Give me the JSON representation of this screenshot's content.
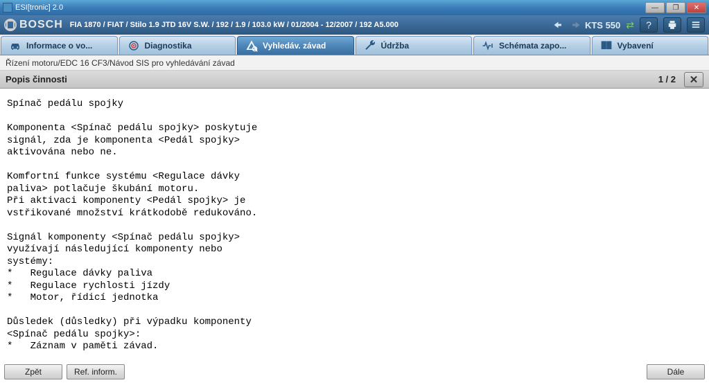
{
  "window": {
    "title": "ESI[tronic] 2.0"
  },
  "header": {
    "brand": "BOSCH",
    "vehicle": "FIA 1870 / FIAT / Stilo 1.9 JTD 16V S.W. / 192 / 1.9 / 103.0 kW / 01/2004 - 12/2007 / 192 A5.000",
    "kts": "KTS 550"
  },
  "tabs": [
    {
      "label": "Informace o vo...",
      "icon": "car-info-icon"
    },
    {
      "label": "Diagnostika",
      "icon": "target-icon"
    },
    {
      "label": "Vyhledáv. závad",
      "icon": "search-fault-icon"
    },
    {
      "label": "Údržba",
      "icon": "wrench-icon"
    },
    {
      "label": "Schémata zapo...",
      "icon": "circuit-icon"
    },
    {
      "label": "Vybavení",
      "icon": "book-icon"
    }
  ],
  "breadcrumb": "Řízení motoru/EDC 16 CF3/Návod SIS pro vyhledávání závad",
  "section": {
    "title": "Popis činnosti",
    "page": "1 / 2"
  },
  "content_text": "Spínač pedálu spojky\n\nKomponenta <Spínač pedálu spojky> poskytuje\nsignál, zda je komponenta <Pedál spojky>\naktivována nebo ne.\n\nKomfortní funkce systému <Regulace dávky\npaliva> potlačuje škubání motoru.\nPři aktivaci komponenty <Pedál spojky> je\nvstřikované množství krátkodobě redukováno.\n\nSignál komponenty <Spínač pedálu spojky>\nvyužívají následující komponenty nebo\nsystémy:\n*   Regulace dávky paliva\n*   Regulace rychlosti jízdy\n*   Motor, řídicí jednotka\n\nDůsledek (důsledky) při výpadku komponenty\n<Spínač pedálu spojky>:\n*   Záznam v paměti závad.",
  "buttons": {
    "back": "Zpět",
    "ref": "Ref. inform.",
    "next": "Dále"
  }
}
